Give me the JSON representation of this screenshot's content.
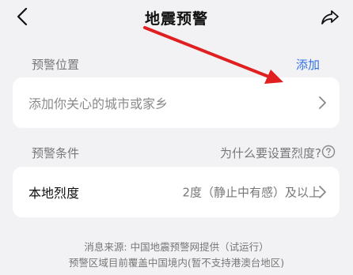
{
  "header": {
    "title": "地震预警"
  },
  "location_section": {
    "label": "预警位置",
    "add_label": "添加",
    "placeholder": "添加你关心的城市或家乡"
  },
  "condition_section": {
    "label": "预警条件",
    "help_text": "为什么要设置烈度?",
    "row_label": "本地烈度",
    "row_value": "2度（静止中有感）及以上"
  },
  "footer": {
    "source": "消息来源: 中国地震预警网提供（试运行）",
    "coverage": "预警区域目前覆盖中国境内(暂不支持港澳台地区)"
  },
  "annotation": {
    "arrow_color": "#e02020"
  }
}
